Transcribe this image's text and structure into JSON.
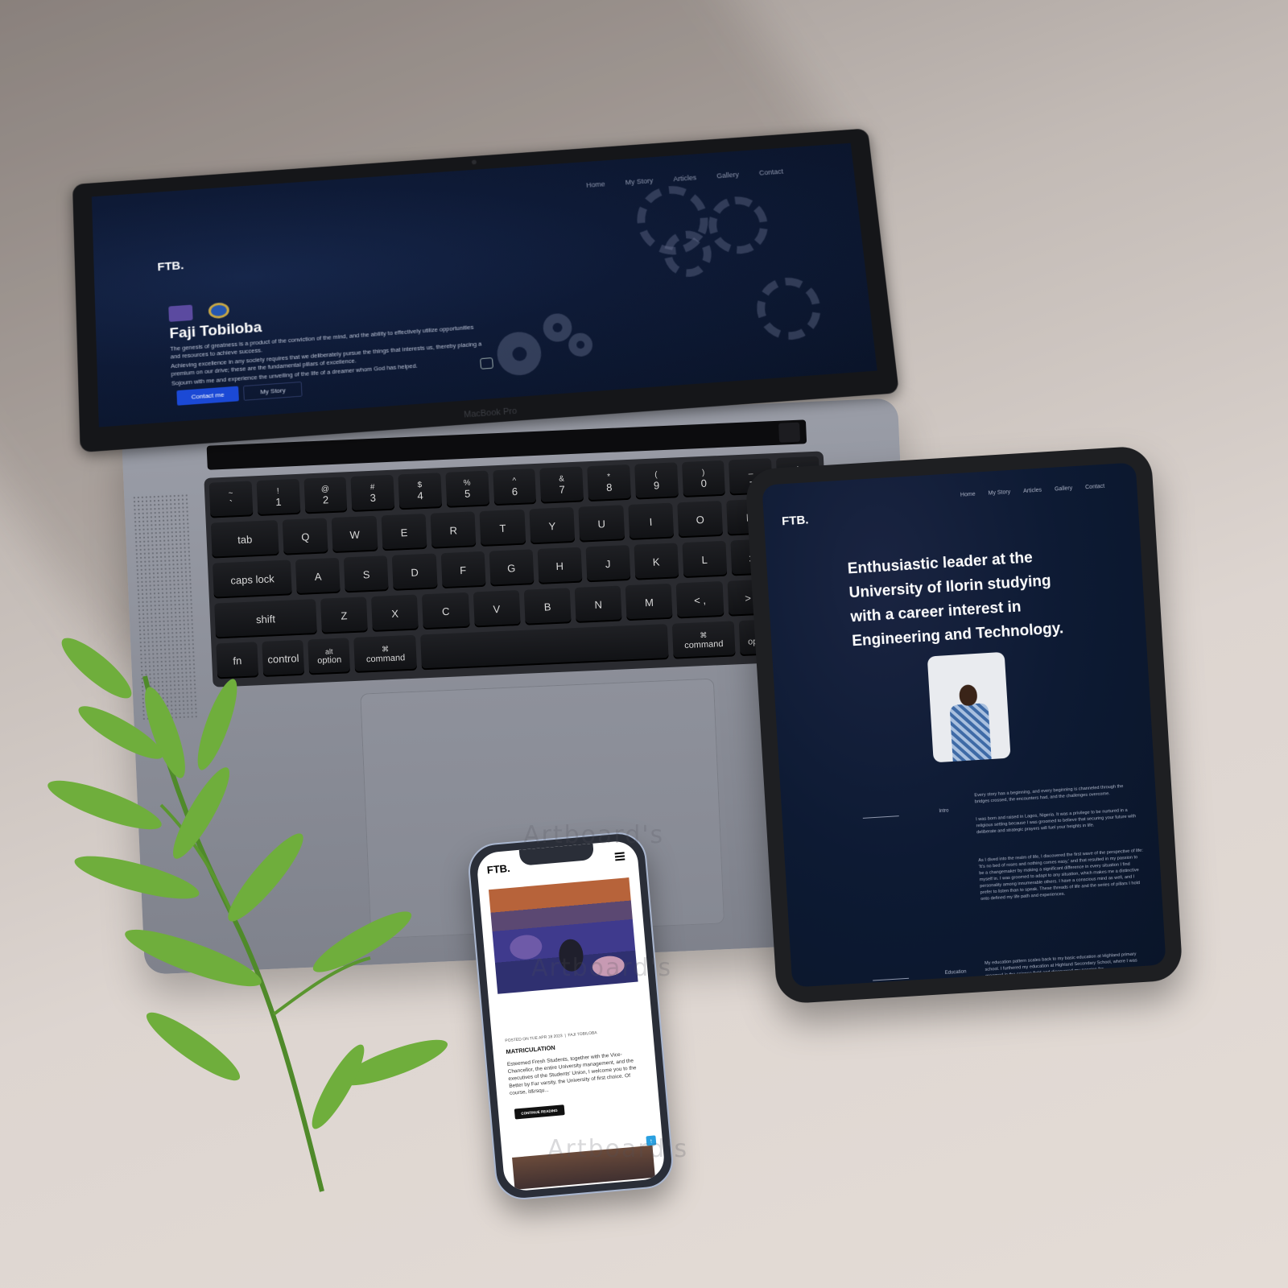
{
  "laptop": {
    "logo": "FTB.",
    "nav": [
      "Home",
      "My Story",
      "Articles",
      "Gallery",
      "Contact"
    ],
    "hero_title": "Faji Tobiloba",
    "paragraph_1": "The genesis of greatness is a product of the conviction of the mind, and the ability to effectively utilize opportunities and resources to achieve success.",
    "paragraph_2": "Achieving excellence in any society requires that we deliberately pursue the things that interests us, thereby placing a premium on our drive; these are the fundamental pillars of excellence.",
    "paragraph_3": "Sojourn with me and experience the unveiling of the life of a dreamer whom God has helped.",
    "contact_button": "Contact me",
    "story_button": "My Story",
    "model_label": "MacBook Pro",
    "keyboard": {
      "row1": [
        [
          "~",
          "`"
        ],
        [
          "!",
          "1"
        ],
        [
          "@",
          "2"
        ],
        [
          "#",
          "3"
        ],
        [
          "$",
          "4"
        ],
        [
          "%",
          "5"
        ],
        [
          "^",
          "6"
        ],
        [
          "&",
          "7"
        ],
        [
          "*",
          "8"
        ],
        [
          "(",
          "9"
        ],
        [
          ")",
          "0"
        ],
        [
          "_",
          "-"
        ],
        [
          "+",
          "="
        ]
      ],
      "row2": [
        "tab",
        "Q",
        "W",
        "E",
        "R",
        "T",
        "Y",
        "U",
        "I",
        "O",
        "P",
        "{ ["
      ],
      "row3": [
        "caps lock",
        "A",
        "S",
        "D",
        "F",
        "G",
        "H",
        "J",
        "K",
        "L",
        ": ;",
        "\" '"
      ],
      "row4": [
        "shift",
        "Z",
        "X",
        "C",
        "V",
        "B",
        "N",
        "M",
        "< ,",
        "> .",
        "? /"
      ],
      "row5": [
        "fn",
        "control",
        "option",
        "command",
        "",
        "command",
        "option",
        "◂"
      ],
      "row5_sub": [
        "",
        "",
        "alt",
        "⌘",
        "",
        "⌘",
        "alt",
        ""
      ]
    }
  },
  "tablet": {
    "logo": "FTB.",
    "nav": [
      "Home",
      "My Story",
      "Articles",
      "Gallery",
      "Contact"
    ],
    "hero": "Enthusiastic leader at the University of Ilorin studying with a career interest in Engineering and Technology.",
    "intro_label": "Intro",
    "intro_text_1": "Every story has a beginning, and every beginning is channeled through the bridges crossed, the encounters had, and the challenges overcome.",
    "intro_text_2": "I was born and raised in Lagos, Nigeria. It was a privilege to be nurtured in a religious setting because I was groomed to believe that securing your future with deliberate and strategic prayers will fuel your heights in life.",
    "intro_text_3": "As I dived into the realm of life, I discovered the first wave of the perspective of life: 'It's no bed of roses and nothing comes easy,' and that resulted in my passion to be a changemaker by making a significant difference in every situation I find myself in. I was groomed to adapt to any situation, which makes me a distinctive personality among innumerable others. I have a conscious mind as well, and I prefer to listen than to speak. These threads of life and the series of pillars I hold onto defined my life path and experiences.",
    "education_label": "Education",
    "education_text": "My education pattern scales back to my basic education at Highland primary school. I furthered my education at Highland Secondary School, where I was groomed in the science field and discovered my passion for"
  },
  "phone": {
    "logo": "FTB.",
    "meta_posted": "POSTED ON TUE APR 18 2023",
    "meta_author": "FAJI TOBILOBA",
    "post_title": "MATRICULATION",
    "post_body": "Esteemed Fresh Students, together with the Vice-Chancellor, the entire University management, and the executives of the Students' Union, I welcome you to the Better by Far varsity, the University of first choice. Of course, it&rsqu...",
    "continue_button": "CONTINUE READING",
    "to_top": "↑"
  },
  "watermark": "Artboard's"
}
